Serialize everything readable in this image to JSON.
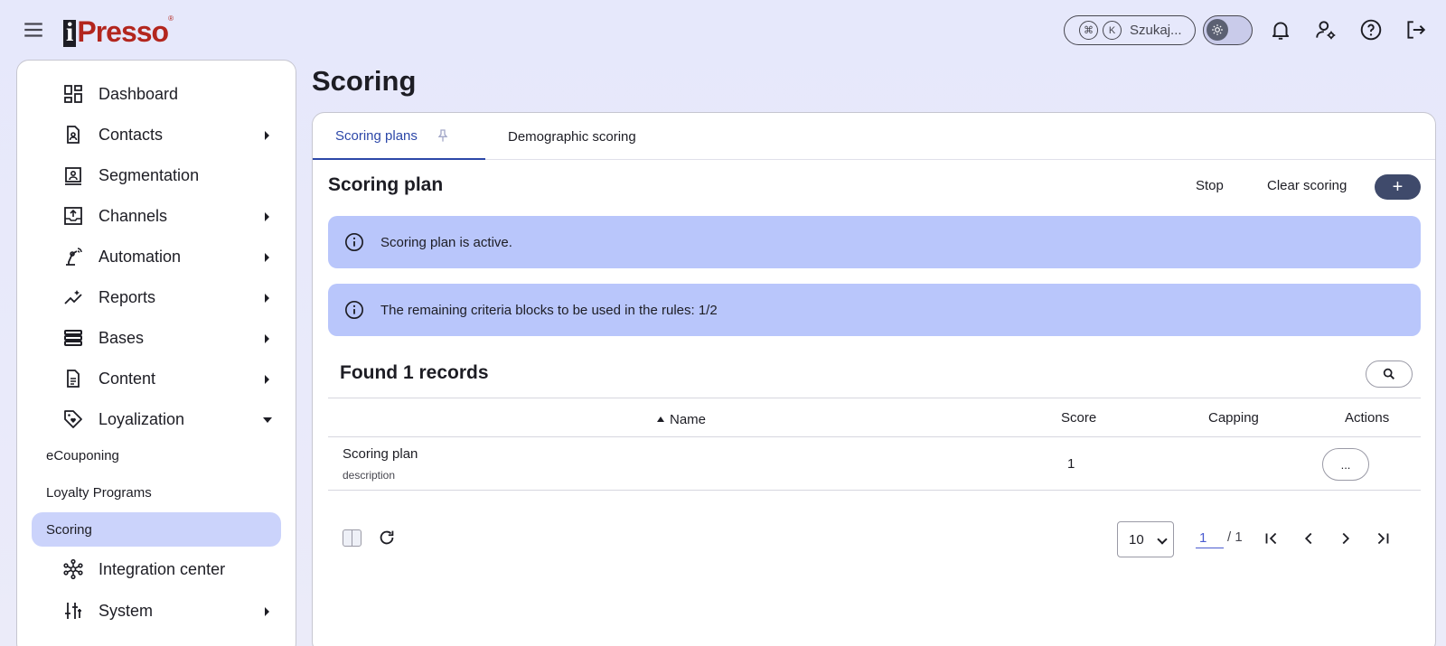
{
  "header": {
    "brand": "iPresso",
    "search": {
      "key1": "⌘",
      "key2": "K",
      "label": "Szukaj..."
    }
  },
  "sidebar": {
    "items": [
      {
        "label": "Dashboard",
        "icon": "dashboard-icon"
      },
      {
        "label": "Contacts",
        "icon": "contacts-icon"
      },
      {
        "label": "Segmentation",
        "icon": "segmentation-icon"
      },
      {
        "label": "Channels",
        "icon": "channels-icon"
      },
      {
        "label": "Automation",
        "icon": "automation-icon"
      },
      {
        "label": "Reports",
        "icon": "reports-icon"
      },
      {
        "label": "Bases",
        "icon": "bases-icon"
      },
      {
        "label": "Content",
        "icon": "content-icon"
      },
      {
        "label": "Loyalization",
        "icon": "loyalization-icon"
      },
      {
        "label": "Integration center",
        "icon": "integration-icon"
      },
      {
        "label": "System",
        "icon": "system-icon"
      }
    ],
    "subitems": [
      {
        "label": "eCouponing"
      },
      {
        "label": "Loyalty Programs"
      },
      {
        "label": "Scoring"
      }
    ]
  },
  "page": {
    "title": "Scoring"
  },
  "tabs": [
    {
      "label": "Scoring plans"
    },
    {
      "label": "Demographic scoring"
    }
  ],
  "section": {
    "title": "Scoring plan",
    "stop_label": "Stop",
    "clear_label": "Clear scoring",
    "add_label": "+"
  },
  "alerts": [
    {
      "text": "Scoring plan is active."
    },
    {
      "text": "The remaining criteria blocks to be used in the rules: 1/2"
    }
  ],
  "records": {
    "title": "Found 1 records"
  },
  "table": {
    "columns": [
      "Name",
      "Score",
      "Capping",
      "Actions"
    ],
    "rows": [
      {
        "name": "Scoring plan",
        "description": "description",
        "score": "1",
        "capping": "",
        "action": "..."
      }
    ]
  },
  "pagination": {
    "page_size": "10",
    "page_size_options": [
      "10"
    ],
    "current_page": "1",
    "total_pages": "/ 1"
  },
  "colors": {
    "accent": "#2c47a8",
    "alert_bg": "#b9c6fb",
    "active_nav_bg": "#cbd3fb",
    "fab_bg": "#3f4a6b",
    "logo_red": "#b3261e"
  }
}
